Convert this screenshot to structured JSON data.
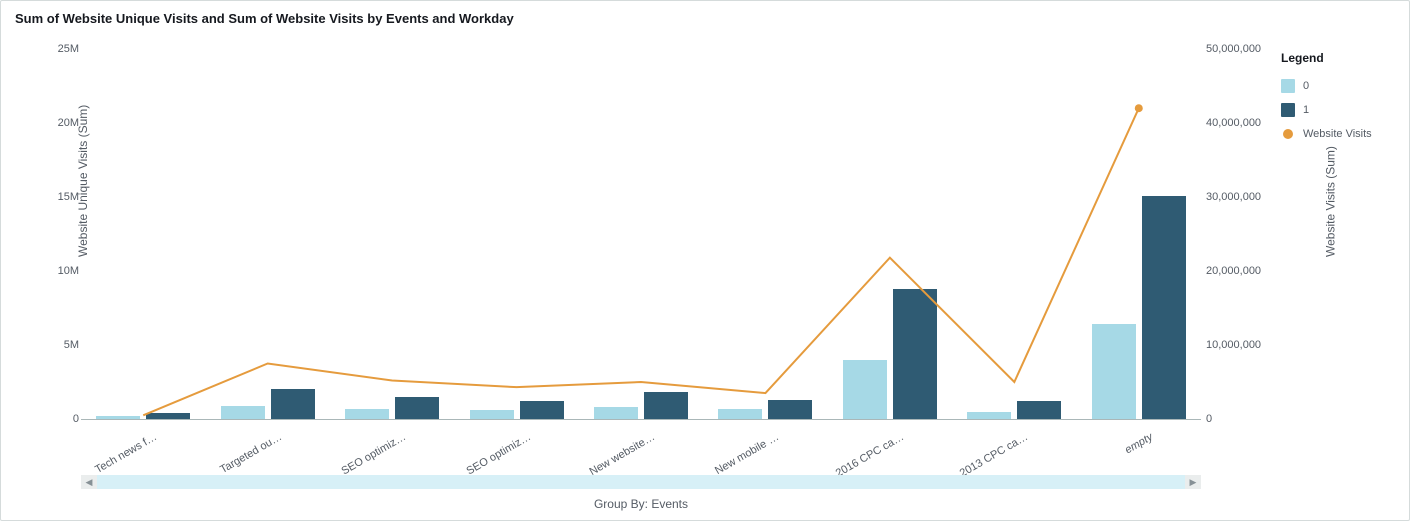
{
  "title": "Sum of Website Unique Visits and Sum of Website Visits by Events and Workday",
  "x_super_label": "Group By: Events",
  "y_label_left": "Website Unique Visits (Sum)",
  "y_label_right": "Website Visits (Sum)",
  "legend_title": "Legend",
  "legend": {
    "s0": "0",
    "s1": "1",
    "line": "Website Visits"
  },
  "chart_data": {
    "type": "bar+line",
    "categories": [
      {
        "label": "Tech news f…",
        "italic": false
      },
      {
        "label": "Targeted ou…",
        "italic": false
      },
      {
        "label": "SEO optimiz…",
        "italic": false
      },
      {
        "label": "SEO optimiz…",
        "italic": false
      },
      {
        "label": "New website…",
        "italic": false
      },
      {
        "label": "New mobile …",
        "italic": false
      },
      {
        "label": "2016 CPC ca…",
        "italic": false
      },
      {
        "label": "2013 CPC ca…",
        "italic": false
      },
      {
        "label": "empty",
        "italic": true
      }
    ],
    "series_bar": [
      {
        "name": "0",
        "values": [
          200000,
          900000,
          700000,
          600000,
          800000,
          700000,
          4000000,
          500000,
          6400000
        ]
      },
      {
        "name": "1",
        "values": [
          400000,
          2000000,
          1500000,
          1200000,
          1800000,
          1300000,
          8800000,
          1200000,
          15100000
        ]
      }
    ],
    "series_line": {
      "name": "Website Visits",
      "values": [
        500000,
        7500000,
        5200000,
        4300000,
        5000000,
        3500000,
        21800000,
        5000000,
        42000000
      ]
    },
    "y_left": {
      "min": 0,
      "max": 25000000,
      "ticks": [
        {
          "v": 0,
          "label": "0"
        },
        {
          "v": 5000000,
          "label": "5M"
        },
        {
          "v": 10000000,
          "label": "10M"
        },
        {
          "v": 15000000,
          "label": "15M"
        },
        {
          "v": 20000000,
          "label": "20M"
        },
        {
          "v": 25000000,
          "label": "25M"
        }
      ]
    },
    "y_right": {
      "min": 0,
      "max": 50000000,
      "ticks": [
        {
          "v": 0,
          "label": "0"
        },
        {
          "v": 10000000,
          "label": "10,000,000"
        },
        {
          "v": 20000000,
          "label": "20,000,000"
        },
        {
          "v": 30000000,
          "label": "30,000,000"
        },
        {
          "v": 40000000,
          "label": "40,000,000"
        },
        {
          "v": 50000000,
          "label": "50,000,000"
        }
      ]
    }
  }
}
